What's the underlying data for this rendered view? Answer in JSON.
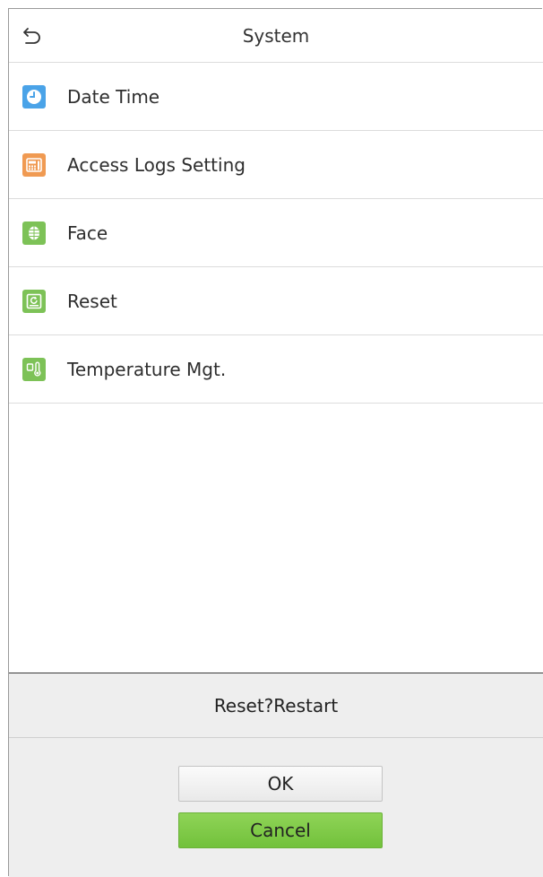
{
  "header": {
    "title": "System",
    "back_icon": "back-arrow-icon"
  },
  "menu": {
    "items": [
      {
        "label": "Date Time",
        "icon": "clock-icon",
        "color": "#4aa3e8"
      },
      {
        "label": "Access Logs Setting",
        "icon": "logs-icon",
        "color": "#f09a52"
      },
      {
        "label": "Face",
        "icon": "face-icon",
        "color": "#7dc257"
      },
      {
        "label": "Reset",
        "icon": "reset-icon",
        "color": "#7dc257"
      },
      {
        "label": "Temperature Mgt.",
        "icon": "thermometer-icon",
        "color": "#7dc257"
      }
    ]
  },
  "dialog": {
    "message": "Reset?Restart",
    "ok_label": "OK",
    "cancel_label": "Cancel",
    "cancel_color": "#7cc646"
  }
}
